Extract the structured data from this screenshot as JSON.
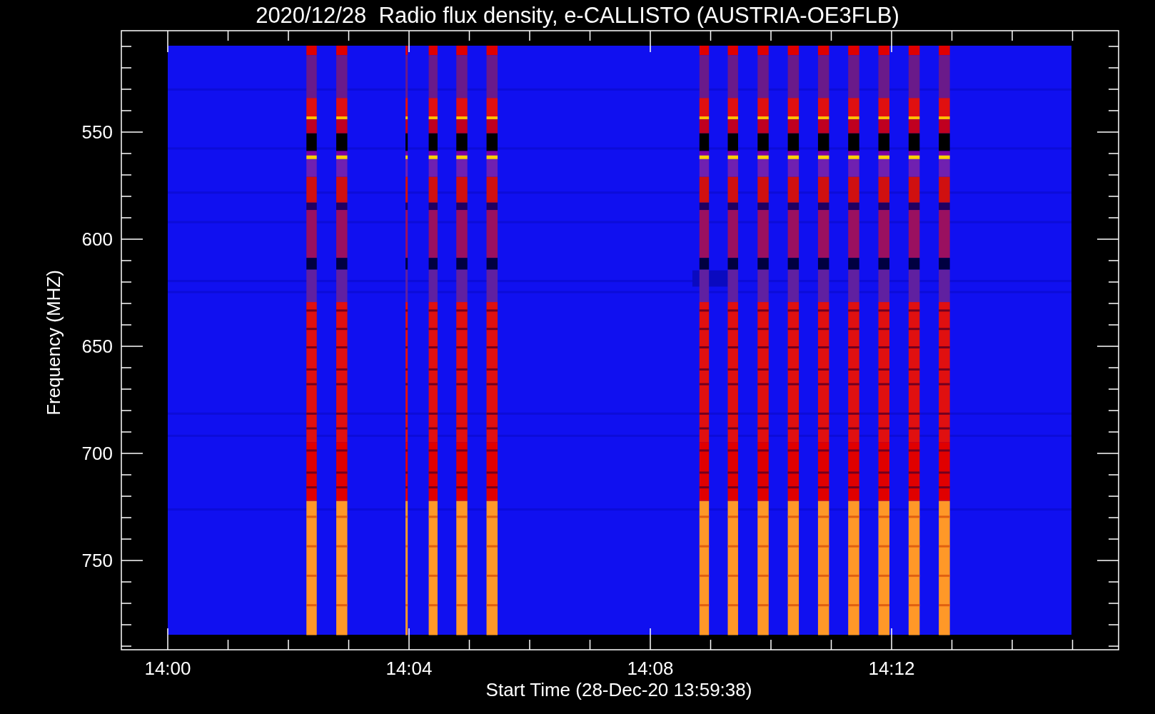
{
  "title": "2020/12/28  Radio flux density, e-CALLISTO (AUSTRIA-OE3FLB)",
  "y_axis": {
    "label": "Frequency (MHZ)",
    "ticks": [
      "550",
      "600",
      "650",
      "700",
      "750"
    ]
  },
  "x_axis": {
    "label": "Start Time (28-Dec-20 13:59:38)",
    "ticks": [
      "14:00",
      "14:04",
      "14:08",
      "14:12"
    ]
  }
}
